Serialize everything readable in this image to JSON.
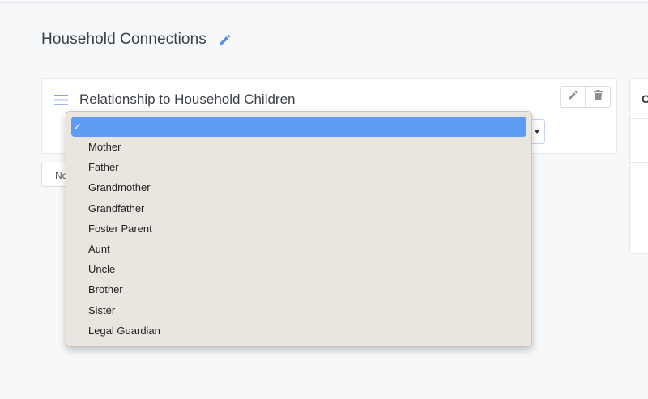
{
  "header": {
    "title": "Household Connections"
  },
  "card": {
    "title": "Relationship to Household Children"
  },
  "ghost_button": {
    "label": "Ne"
  },
  "side_card": {
    "letter": "C"
  },
  "dropdown": {
    "selected_mark": "✓",
    "selected_value": "",
    "options": [
      "Mother",
      "Father",
      "Grandmother",
      "Grandfather",
      "Foster Parent",
      "Aunt",
      "Uncle",
      "Brother",
      "Sister",
      "Legal Guardian"
    ]
  },
  "icons": {
    "title_edit": "pencil-icon",
    "drag": "drag-handle-icon",
    "edit": "pencil-icon",
    "delete": "trash-icon",
    "select_caret": "caret-down-icon"
  },
  "colors": {
    "accent": "#5e9cf6",
    "edit_icon": "#5b8ce8",
    "dropdown_bg": "#ebe5e0"
  }
}
